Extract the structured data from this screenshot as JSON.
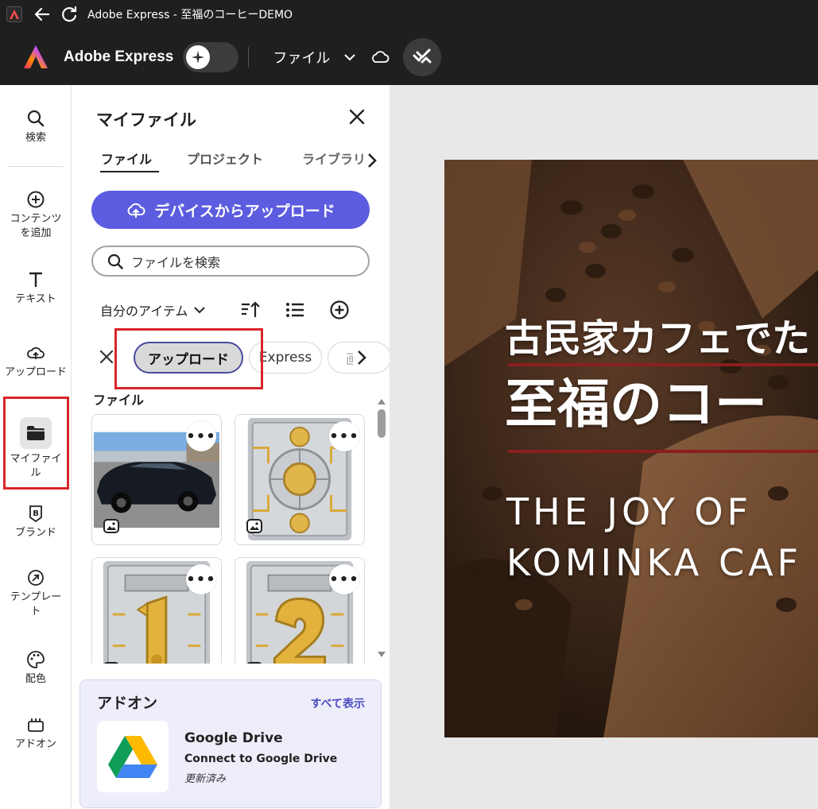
{
  "window": {
    "title": "Adobe Express - 至福のコーヒーDEMO"
  },
  "header": {
    "brand": "Adobe Express",
    "file_menu": "ファイル"
  },
  "rail": {
    "items": [
      {
        "label": "検索",
        "icon": "search-icon"
      },
      {
        "label": "コンテンツを追加",
        "icon": "add-circle-icon"
      },
      {
        "label": "テキスト",
        "icon": "text-icon"
      },
      {
        "label": "アップロード",
        "icon": "cloud-upload-icon"
      },
      {
        "label": "マイファイル",
        "icon": "folder-icon"
      },
      {
        "label": "ブランド",
        "icon": "brand-icon"
      },
      {
        "label": "テンプレート",
        "icon": "template-icon"
      },
      {
        "label": "配色",
        "icon": "palette-icon"
      },
      {
        "label": "アドオン",
        "icon": "addon-icon"
      }
    ]
  },
  "panel": {
    "title": "マイファイル",
    "tabs": [
      {
        "label": "ファイル",
        "active": true
      },
      {
        "label": "プロジェクト",
        "active": false
      },
      {
        "label": "ライブラリ",
        "active": false
      }
    ],
    "upload_button": "デバイスからアップロード",
    "search_placeholder": "ファイルを検索",
    "owner_filter": "自分のアイテム",
    "chips": [
      {
        "label": "アップロード",
        "selected": true
      },
      {
        "label": "Express",
        "selected": false
      },
      {
        "label": "画",
        "selected": false
      }
    ],
    "section_label": "ファイル",
    "files": [
      {
        "kind": "car-photo"
      },
      {
        "kind": "mechanical-panel"
      },
      {
        "kind": "number-panel",
        "digit": "1"
      },
      {
        "kind": "number-panel",
        "digit": "2"
      }
    ],
    "more_label": "•••",
    "addons": {
      "title": "アドオン",
      "show_all": "すべて表示",
      "item": {
        "name": "Google Drive",
        "description": "Connect to Google Drive",
        "status": "更新済み"
      }
    }
  },
  "design": {
    "line1": "古民家カフェでた",
    "line2": "至福のコー",
    "line3": "THE JOY OF",
    "line4": "KOMINKA CAF"
  },
  "colors": {
    "accent": "#5c5ce0",
    "highlight": "#d9252a",
    "header_bg": "#1f1f1f"
  }
}
